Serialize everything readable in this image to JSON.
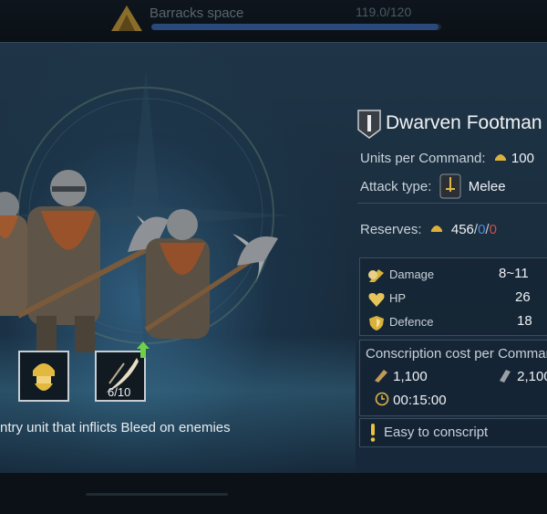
{
  "topbar": {
    "barracks_label": "Barracks space",
    "count_text": "119.0/120",
    "capacity_fraction": 0.99,
    "icon": "barracks-icon"
  },
  "unit": {
    "name": "Dwarven Footman",
    "rank_icon": "rank-badge-icon",
    "units_per_command_label": "Units per Command:",
    "units_per_command_value": "100",
    "attack_type_label": "Attack type:",
    "attack_type_value": "Melee",
    "reserves_label": "Reserves:",
    "reserves_value": "456",
    "reserves_slash1": "/",
    "reserves_blue": "0",
    "reserves_slash2": "/",
    "reserves_red": "0"
  },
  "stats": [
    {
      "label": "Damage",
      "value": "8~11",
      "icon": "damage-icon"
    },
    {
      "label": "HP",
      "value": "26",
      "icon": "heart-icon"
    },
    {
      "label": "Defence",
      "value": "18",
      "icon": "shield-icon"
    }
  ],
  "cost": {
    "header": "Conscription cost per Command",
    "wood": "1,100",
    "iron": "2,100",
    "time": "00:15:00"
  },
  "tip": {
    "icon": "exclamation-icon",
    "text": "Easy to conscript"
  },
  "abilities": [
    {
      "name": "dwarf-armor-ability",
      "level_text": ""
    },
    {
      "name": "bleed-ability",
      "level_text": "6/10"
    }
  ],
  "description": "ntry unit that inflicts Bleed on enemies",
  "colors": {
    "accent_gold": "#e0b640",
    "blue": "#4f8ad8",
    "red": "#d64a4a",
    "upgrade_green": "#6fd04a"
  }
}
